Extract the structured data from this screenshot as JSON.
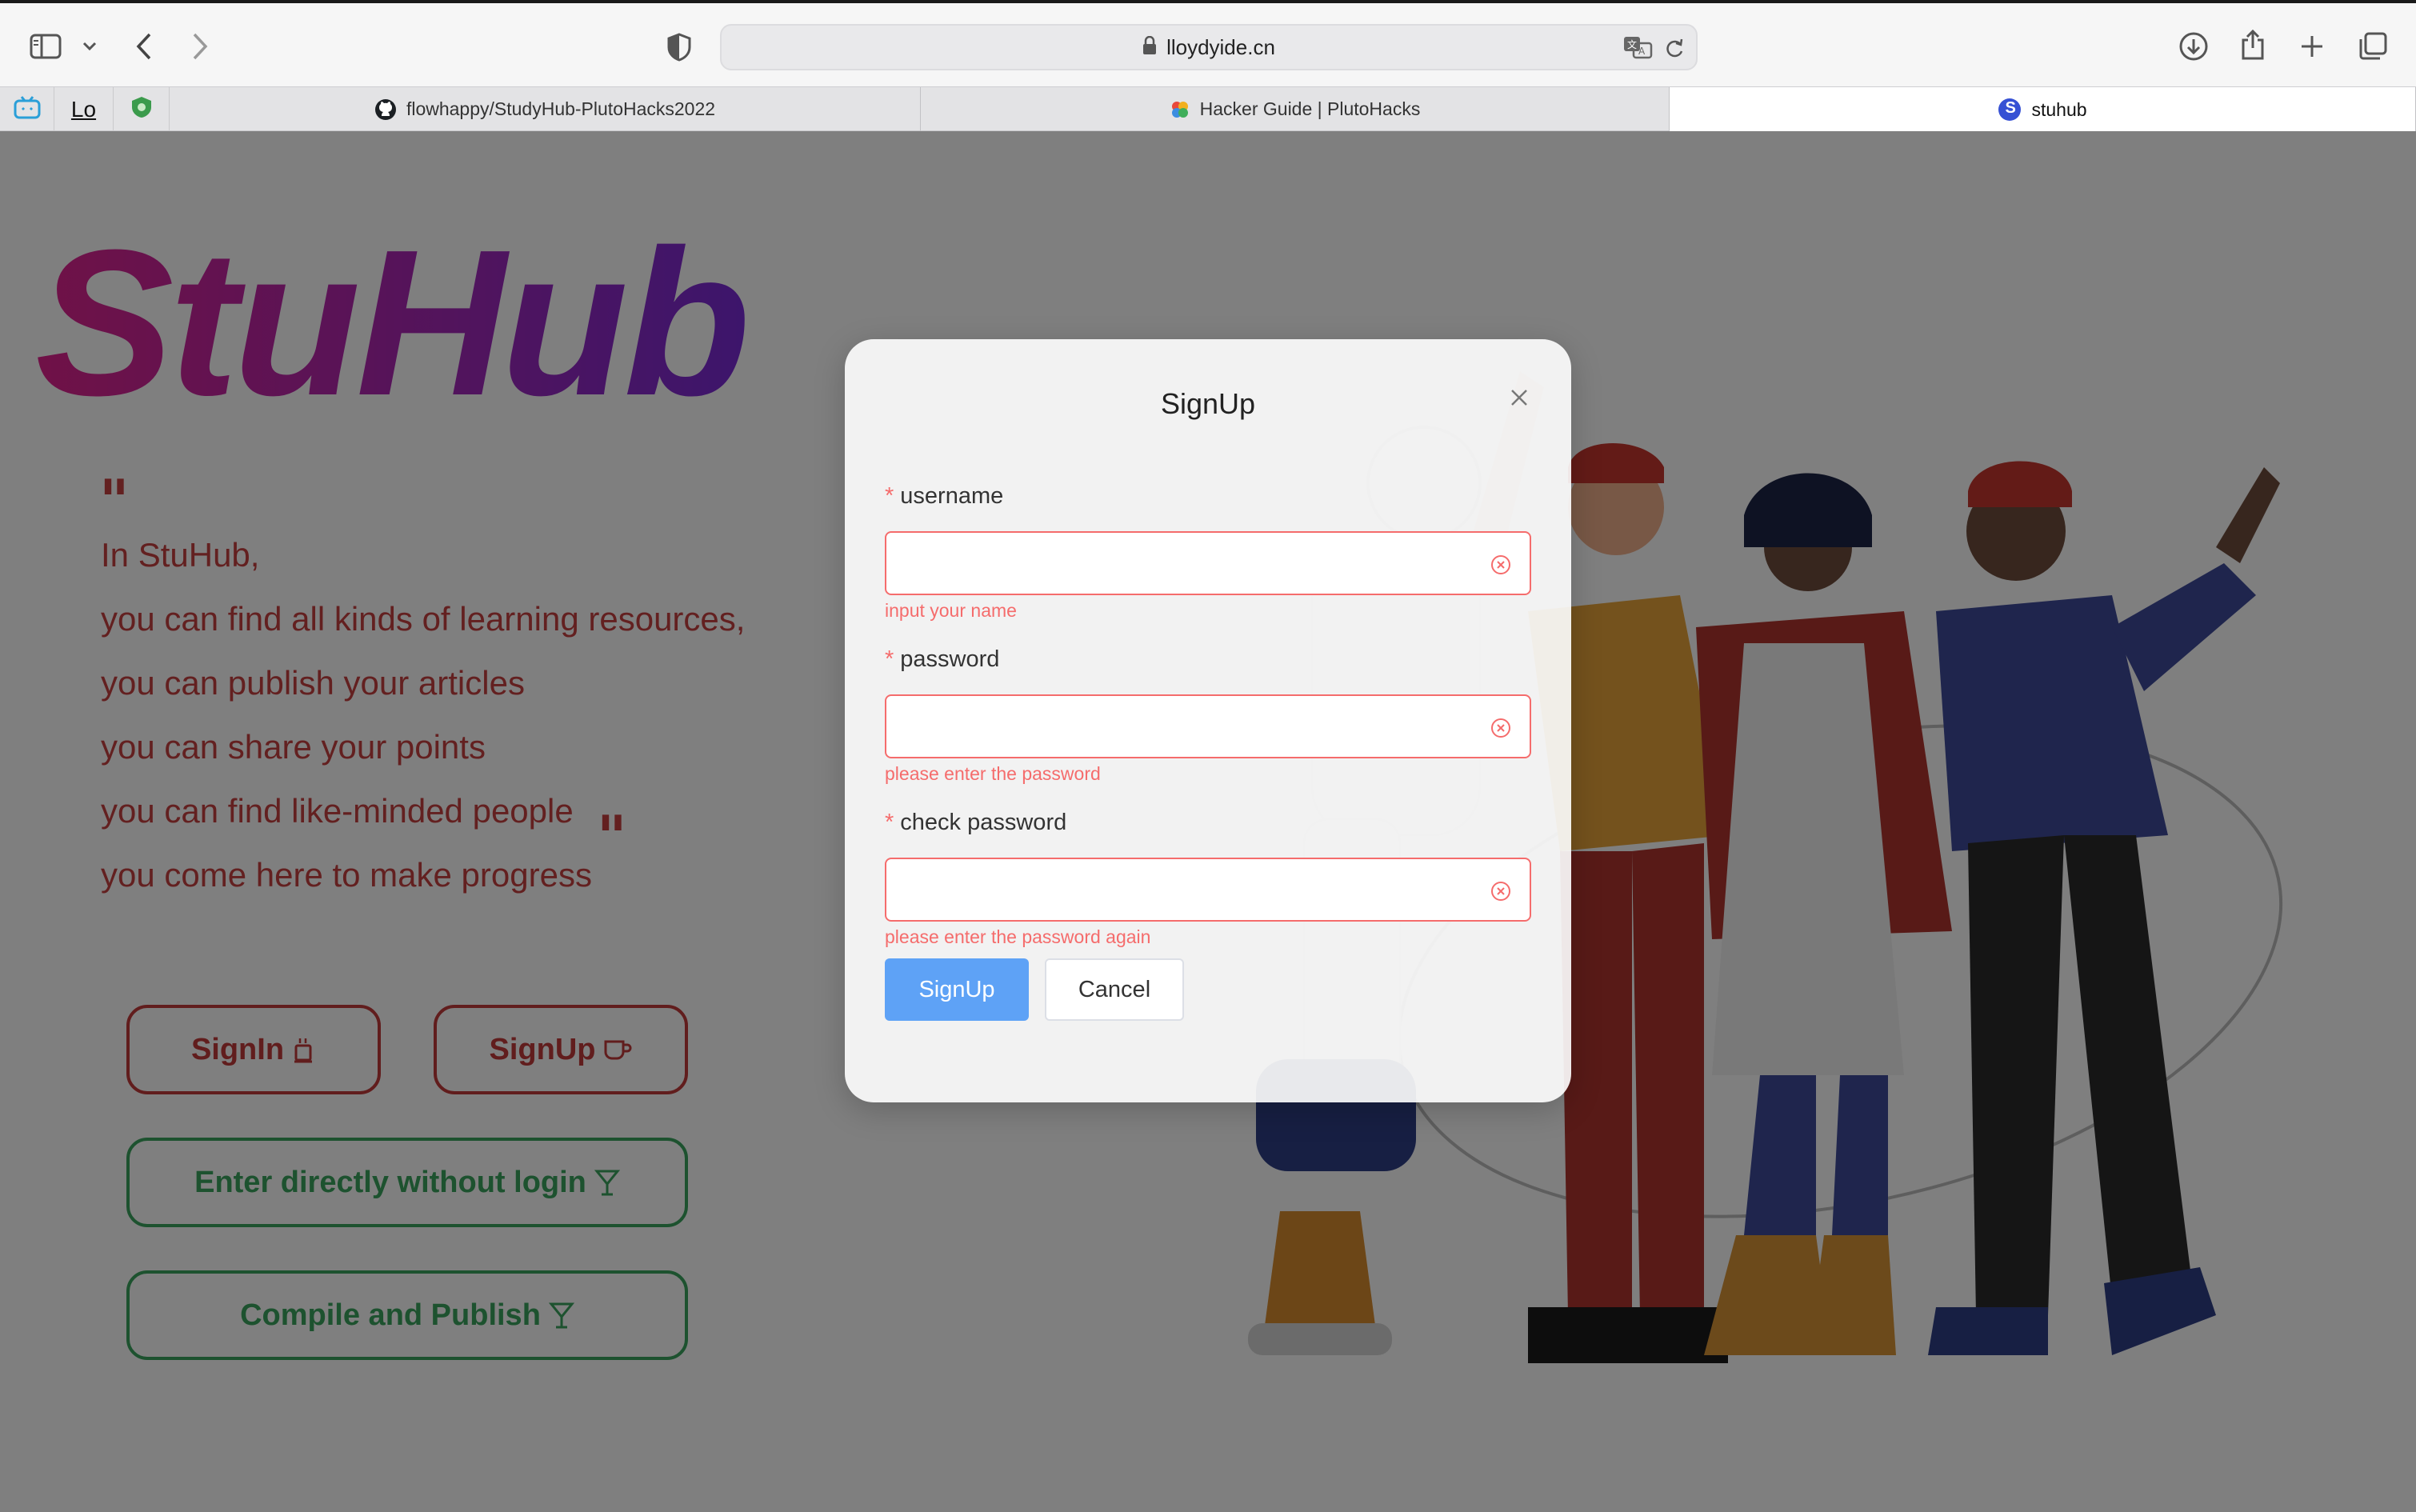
{
  "browser": {
    "url": "lloydyide.cn",
    "pinned_tabs": [
      "bilibili-tv-icon",
      "Lo",
      "shield-icon"
    ],
    "tabs": [
      {
        "label": "flowhappy/StudyHub-PlutoHacks2022",
        "icon": "github-icon",
        "active": false
      },
      {
        "label": "Hacker Guide | PlutoHacks",
        "icon": "flower-icon",
        "active": false
      },
      {
        "label": "stuhub",
        "icon": "s-logo-icon",
        "active": true
      }
    ],
    "pinned_text": "Lo",
    "s_logo": "S"
  },
  "landing": {
    "logo": "StuHub",
    "quote_open": "\"",
    "quote_close": "\"",
    "intro_lines": [
      "In StuHub,",
      "you can find all kinds of learning resources,",
      "you can publish your articles",
      "you can share your points",
      "you can find like-minded people",
      "you come here to make progress"
    ],
    "buttons": {
      "signin": "SignIn",
      "signup": "SignUp",
      "enter_direct": "Enter directly without login",
      "compile": "Compile and Publish"
    }
  },
  "modal": {
    "title": "SignUp",
    "required_mark": "*",
    "fields": [
      {
        "label": "username",
        "value": "",
        "error": "input your name"
      },
      {
        "label": "password",
        "value": "",
        "error": "please enter the password"
      },
      {
        "label": "check password",
        "value": "",
        "error": "please enter the password again"
      }
    ],
    "submit": "SignUp",
    "cancel": "Cancel"
  },
  "colors": {
    "accent_red": "#c23b3b",
    "accent_green": "#3aa55e",
    "error": "#f56c6c",
    "primary": "#5ea2f6",
    "logo_gradient": [
      "#e0238e",
      "#7a2bd8"
    ]
  }
}
